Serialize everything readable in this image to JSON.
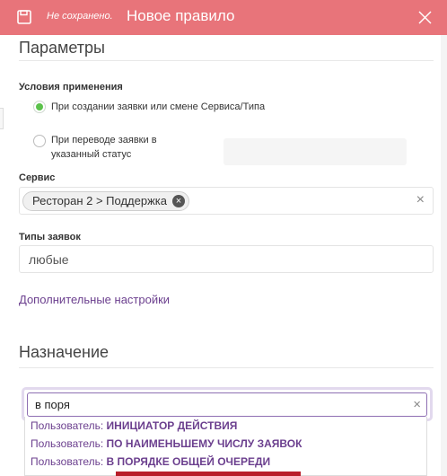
{
  "header": {
    "status": "Не сохранено.",
    "title": "Новое правило",
    "icons": {
      "save": "save-icon",
      "close": "close-icon"
    },
    "color": "#e8747a"
  },
  "parameters": {
    "title": "Параметры",
    "conditions_label": "Условия применения",
    "condition_create": "При создании заявки или смене Сервиса/Типа",
    "condition_transition_line1": "При переводе заявки в",
    "condition_transition_line2": "указанный статус",
    "service_label": "Сервис",
    "service_chip": "Ресторан 2 > Поддержка",
    "types_label": "Типы заявок",
    "types_value": "любые",
    "advanced_link": "Дополнительные настройки"
  },
  "assignment": {
    "title": "Назначение",
    "search_value": "в поря",
    "options": [
      {
        "prefix": "Пользователь: ",
        "value": "ИНИЦИАТОР ДЕЙСТВИЯ"
      },
      {
        "prefix": "Пользователь: ",
        "value": "ПО НАИМЕНЬШЕМУ ЧИСЛУ ЗАЯВОК"
      },
      {
        "prefix": "Пользователь: ",
        "value": "В ПОРЯДКЕ ОБЩЕЙ ОЧЕРЕДИ"
      }
    ]
  },
  "colors": {
    "accent": "#6b3f8e",
    "radio_selected": "#5cc24c",
    "highlight": "#b81d2a"
  }
}
